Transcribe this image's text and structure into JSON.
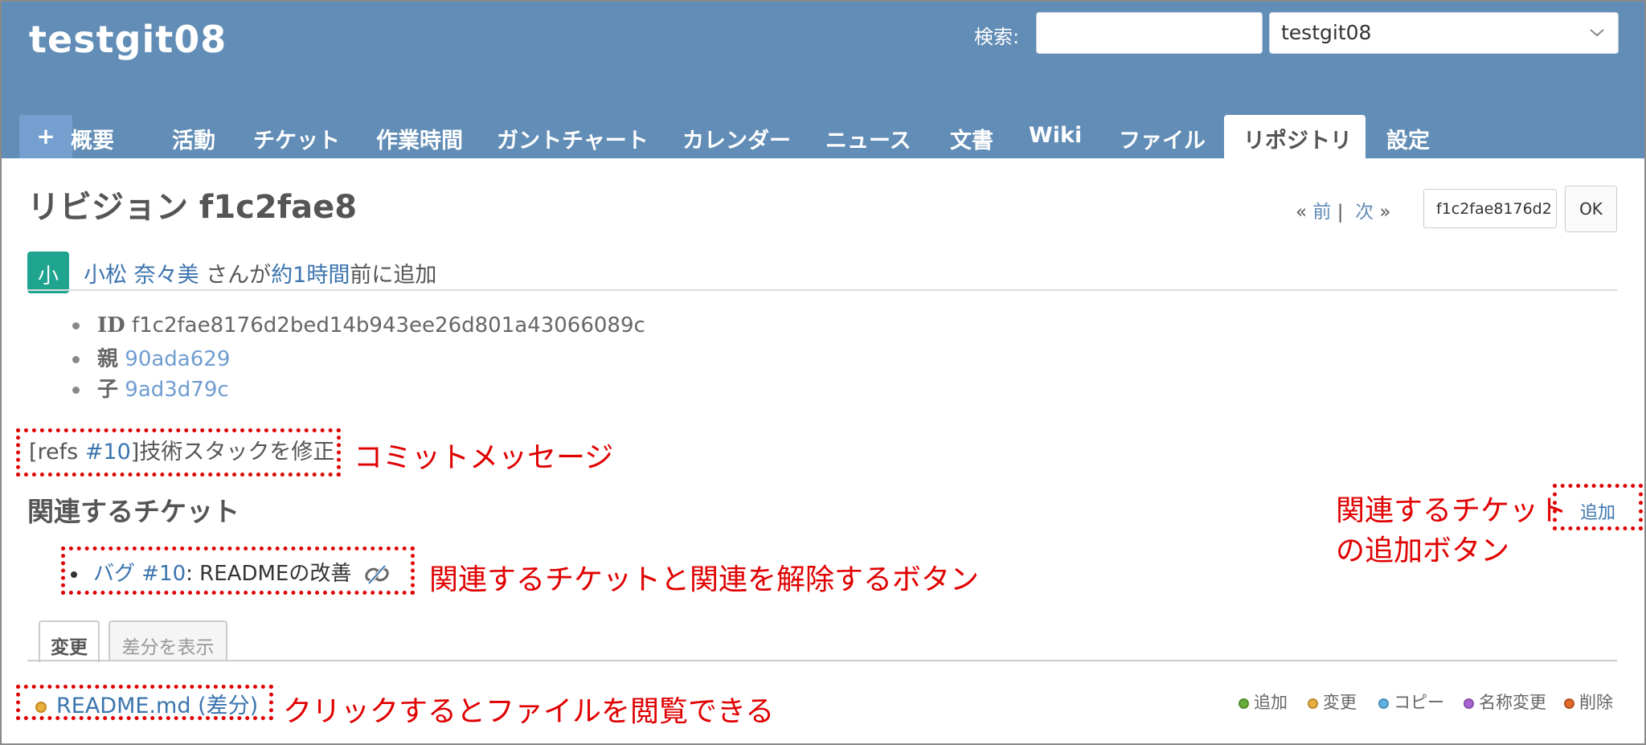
{
  "header": {
    "project_title": "testgit08",
    "search_label": "検索:",
    "search_placeholder": "",
    "project_select_value": "testgit08"
  },
  "tabs": [
    {
      "label": "+"
    },
    {
      "label": "概要"
    },
    {
      "label": "活動"
    },
    {
      "label": "チケット"
    },
    {
      "label": "作業時間"
    },
    {
      "label": "ガントチャート"
    },
    {
      "label": "カレンダー"
    },
    {
      "label": "ニュース"
    },
    {
      "label": "文書"
    },
    {
      "label": "Wiki"
    },
    {
      "label": "ファイル"
    },
    {
      "label": "リポジトリ",
      "selected": true
    },
    {
      "label": "設定"
    }
  ],
  "revision": {
    "title": "リビジョン f1c2fae8",
    "nav_prev_arrow": "«",
    "nav_prev": "前",
    "nav_separator": "|",
    "nav_next": "次",
    "nav_next_arrow": "»",
    "rev_input_value": "f1c2fae8176d2",
    "ok_label": "OK"
  },
  "author": {
    "avatar_initial": "小",
    "name": "小松 奈々美",
    "text_mid": " さんが",
    "time_link": "約1時間",
    "text_end": "前に追加"
  },
  "info": {
    "id_label": "ID",
    "id_value": "f1c2fae8176d2bed14b943ee26d801a43066089c",
    "parent_label": "親",
    "parent_value": "90ada629",
    "child_label": "子",
    "child_value": "9ad3d79c"
  },
  "commit_message": {
    "prefix": "[refs ",
    "issue_link": "#10",
    "suffix": "]技術スタックを修正"
  },
  "related": {
    "heading": "関連するチケット",
    "add_label": "追加",
    "item_link": "バグ #10",
    "item_text": ": READMEの改善"
  },
  "changes_tabs": {
    "changes": "変更",
    "diff": "差分を表示"
  },
  "file": {
    "name": "README.md",
    "diff_link": "(差分)"
  },
  "legend": [
    {
      "label": "追加",
      "color": "#6aae3a"
    },
    {
      "label": "変更",
      "color": "#e8ae3e"
    },
    {
      "label": "コピー",
      "color": "#5fb0e4"
    },
    {
      "label": "名称変更",
      "color": "#a962d4"
    },
    {
      "label": "削除",
      "color": "#e06a2c"
    }
  ],
  "annotations": {
    "commit": "コミットメッセージ",
    "related_unlink": "関連するチケットと関連を解除するボタン",
    "add_related_line1": "関連するチケット",
    "add_related_line2": "の追加ボタン",
    "file_view": "クリックするとファイルを閲覧できる"
  },
  "colors": {
    "header_bg": "#628db6",
    "link": "#3b74ae",
    "annotation": "#e00000",
    "avatar_bg": "#1fa58f"
  }
}
